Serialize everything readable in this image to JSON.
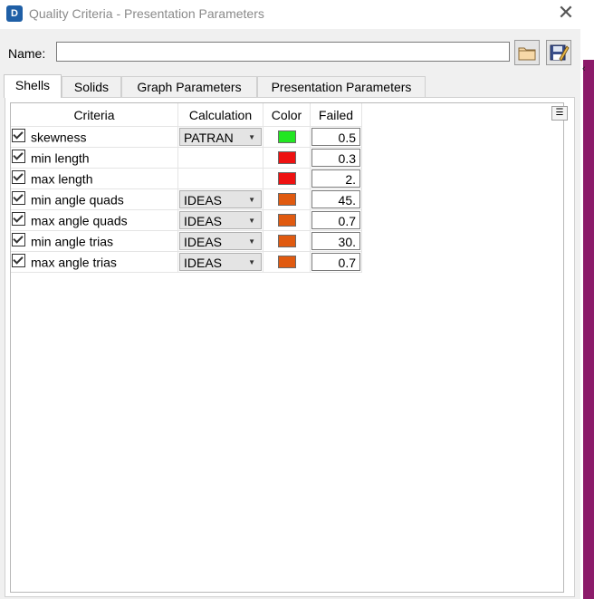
{
  "window": {
    "title": "Quality Criteria - Presentation Parameters",
    "close_glyph": "✕",
    "app_icon": "logo-icon"
  },
  "name_field": {
    "label": "Name:",
    "value": "",
    "placeholder": ""
  },
  "toolbar": {
    "open_icon": "folder-open-icon",
    "save_icon": "save-icon"
  },
  "tabs": [
    {
      "label": "Shells",
      "active": true
    },
    {
      "label": "Solids",
      "active": false
    },
    {
      "label": "Graph Parameters",
      "active": false
    },
    {
      "label": "Presentation Parameters",
      "active": false
    }
  ],
  "table": {
    "headers": {
      "criteria": "Criteria",
      "calculation": "Calculation",
      "color": "Color",
      "failed": "Failed"
    },
    "menu_icon": "column-options-icon",
    "rows": [
      {
        "checked": true,
        "criteria": "skewness",
        "calculation": "PATRAN",
        "color": "#22e622",
        "failed": "0.5"
      },
      {
        "checked": true,
        "criteria": "min length",
        "calculation": "",
        "color": "#ee1111",
        "failed": "0.3"
      },
      {
        "checked": true,
        "criteria": "max length",
        "calculation": "",
        "color": "#ee1111",
        "failed": "2."
      },
      {
        "checked": true,
        "criteria": "min angle quads",
        "calculation": "IDEAS",
        "color": "#e05a10",
        "failed": "45."
      },
      {
        "checked": true,
        "criteria": "max angle quads",
        "calculation": "IDEAS",
        "color": "#e05a10",
        "failed": "0.7"
      },
      {
        "checked": true,
        "criteria": "min angle trias",
        "calculation": "IDEAS",
        "color": "#e05a10",
        "failed": "30."
      },
      {
        "checked": true,
        "criteria": "max angle trias",
        "calculation": "IDEAS",
        "color": "#e05a10",
        "failed": "0.7"
      }
    ]
  }
}
